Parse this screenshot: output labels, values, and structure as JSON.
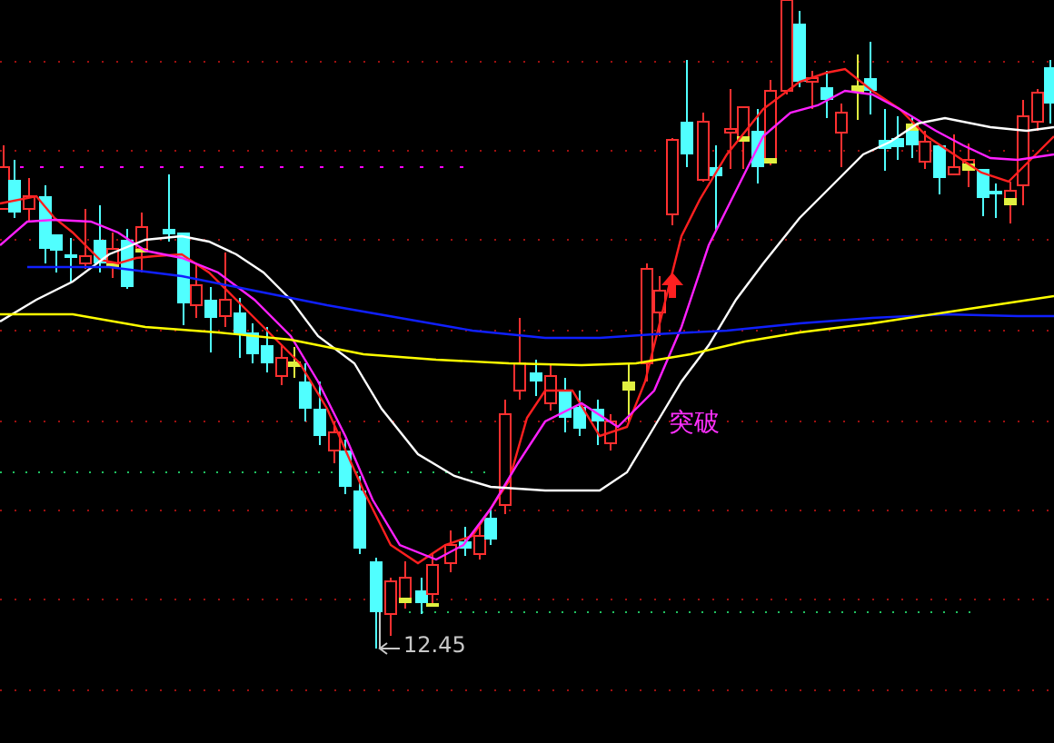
{
  "chart": {
    "low_price_label": "12.45",
    "signal_label": "突破"
  }
}
